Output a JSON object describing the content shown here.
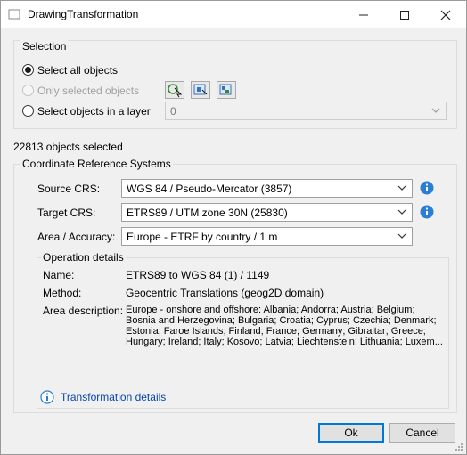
{
  "window": {
    "title": "DrawingTransformation",
    "minimize_icon": "minimize-icon",
    "maximize_icon": "maximize-icon",
    "close_icon": "close-icon"
  },
  "selection": {
    "group_label": "Selection",
    "select_all_label": "Select all objects",
    "only_selected_label": "Only selected objects",
    "select_in_layer_label": "Select objects in a layer",
    "layer_value": "0",
    "selected_option": "Select all objects",
    "tool_icons": [
      "pick-objects-icon",
      "select-objects-icon",
      "select-layer-objects-icon"
    ]
  },
  "status": {
    "objects_selected": "22813 objects selected"
  },
  "crs": {
    "group_label": "Coordinate Reference Systems",
    "source_label": "Source CRS:",
    "source_value": "WGS 84 / Pseudo-Mercator (3857)",
    "target_label": "Target CRS:",
    "target_value": "ETRS89 / UTM zone 30N (25830)",
    "area_label": "Area / Accuracy:",
    "area_value": "Europe - ETRF by country / 1 m"
  },
  "operation": {
    "group_label": "Operation details",
    "name_label": "Name:",
    "name_value": "ETRS89 to WGS 84 (1) / 1149",
    "method_label": "Method:",
    "method_value": "Geocentric Translations (geog2D domain)",
    "area_label": "Area description:",
    "area_value": "Europe - onshore and offshore: Albania; Andorra; Austria; Belgium; Bosnia and Herzegovina; Bulgaria; Croatia; Cyprus; Czechia; Denmark; Estonia; Faroe Islands; Finland; France; Germany; Gibraltar; Greece; Hungary; Ireland; Italy; Kosovo; Latvia; Liechtenstein; Lithuania; Luxem...",
    "details_link": "Transformation details"
  },
  "buttons": {
    "ok": "Ok",
    "cancel": "Cancel"
  },
  "colors": {
    "info_blue": "#2a7fd4",
    "link_blue": "#0645ad",
    "default_border": "#0078d7"
  }
}
